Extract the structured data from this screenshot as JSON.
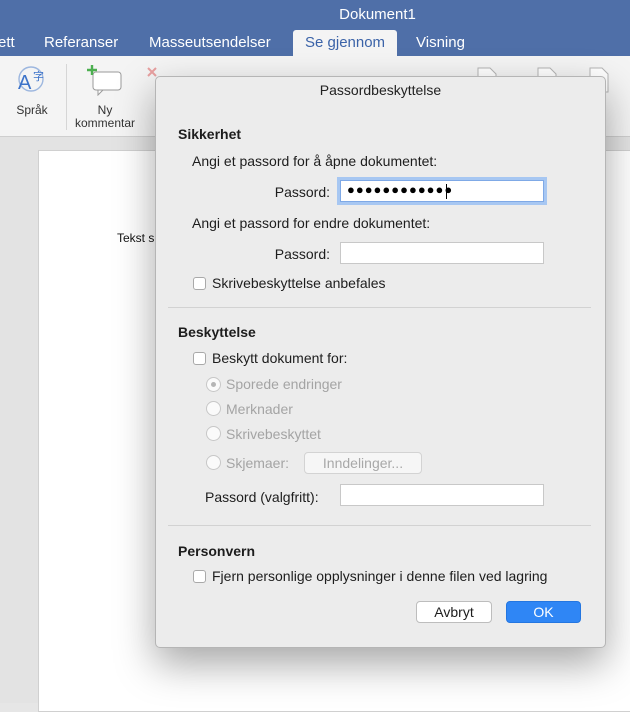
{
  "window": {
    "title": "Dokument1",
    "tabs": [
      {
        "label": "ett"
      },
      {
        "label": "Referanser"
      },
      {
        "label": "Masseutsendelser"
      },
      {
        "label": "Se gjennom"
      },
      {
        "label": "Visning"
      }
    ],
    "active_tab": "Se gjennom"
  },
  "ribbon": {
    "language_label": "Språk",
    "comment_label_line1": "Ny",
    "comment_label_line2": "kommentar"
  },
  "document": {
    "text": "Tekst s"
  },
  "dialog": {
    "title": "Passordbeskyttelse",
    "security": {
      "heading": "Sikkerhet",
      "open_prompt": "Angi et passord for å åpne dokumentet:",
      "open_password_label": "Passord:",
      "open_password_value": "●●●●●●●●●●●●",
      "modify_prompt": "Angi et passord for endre dokumentet:",
      "modify_password_label": "Passord:",
      "modify_password_value": "",
      "readonly_label": "Skrivebeskyttelse anbefales"
    },
    "protection": {
      "heading": "Beskyttelse",
      "protect_label": "Beskytt dokument for:",
      "options": [
        {
          "label": "Sporede endringer"
        },
        {
          "label": "Merknader"
        },
        {
          "label": "Skrivebeskyttet"
        },
        {
          "label": "Skjemaer:"
        }
      ],
      "sections_button": "Inndelinger...",
      "optional_password_label": "Passord (valgfritt):",
      "optional_password_value": ""
    },
    "privacy": {
      "heading": "Personvern",
      "remove_info_label": "Fjern personlige opplysninger i denne filen ved lagring"
    },
    "buttons": {
      "cancel": "Avbryt",
      "ok": "OK"
    }
  },
  "colors": {
    "titlebar": "#4f6fa8",
    "accent_blue": "#2f86f5",
    "dialog_bg": "#ececec"
  }
}
